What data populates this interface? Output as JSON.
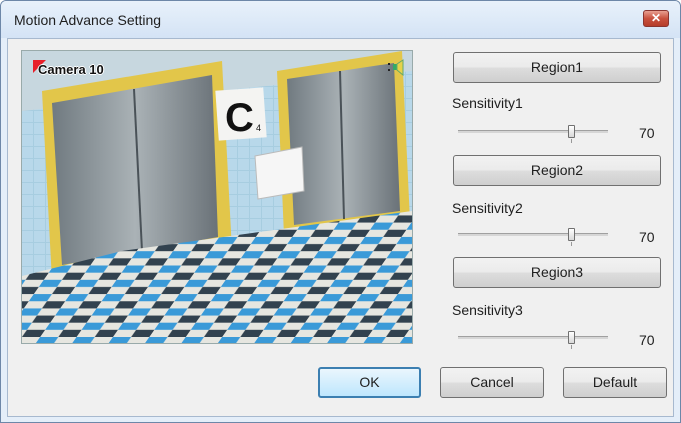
{
  "window": {
    "title": "Motion Advance Setting",
    "close_label": "✕"
  },
  "camera": {
    "label": "Camera 10",
    "sign_text": "C",
    "sign_sub": "4"
  },
  "regions": [
    {
      "button": "Region1",
      "label": "Sensitivity1",
      "value": "70",
      "level_percent": 75
    },
    {
      "button": "Region2",
      "label": "Sensitivity2",
      "value": "70",
      "level_percent": 75
    },
    {
      "button": "Region3",
      "label": "Sensitivity3",
      "value": "70",
      "level_percent": 75
    }
  ],
  "buttons": {
    "ok": "OK",
    "cancel": "Cancel",
    "default": "Default"
  },
  "colors": {
    "title_bg": "#d4e3f5",
    "close_red": "#c9513e",
    "ok_border": "#3c7fb1"
  },
  "icons": [
    "close-icon",
    "record-indicator-icon",
    "speaker-icon"
  ]
}
